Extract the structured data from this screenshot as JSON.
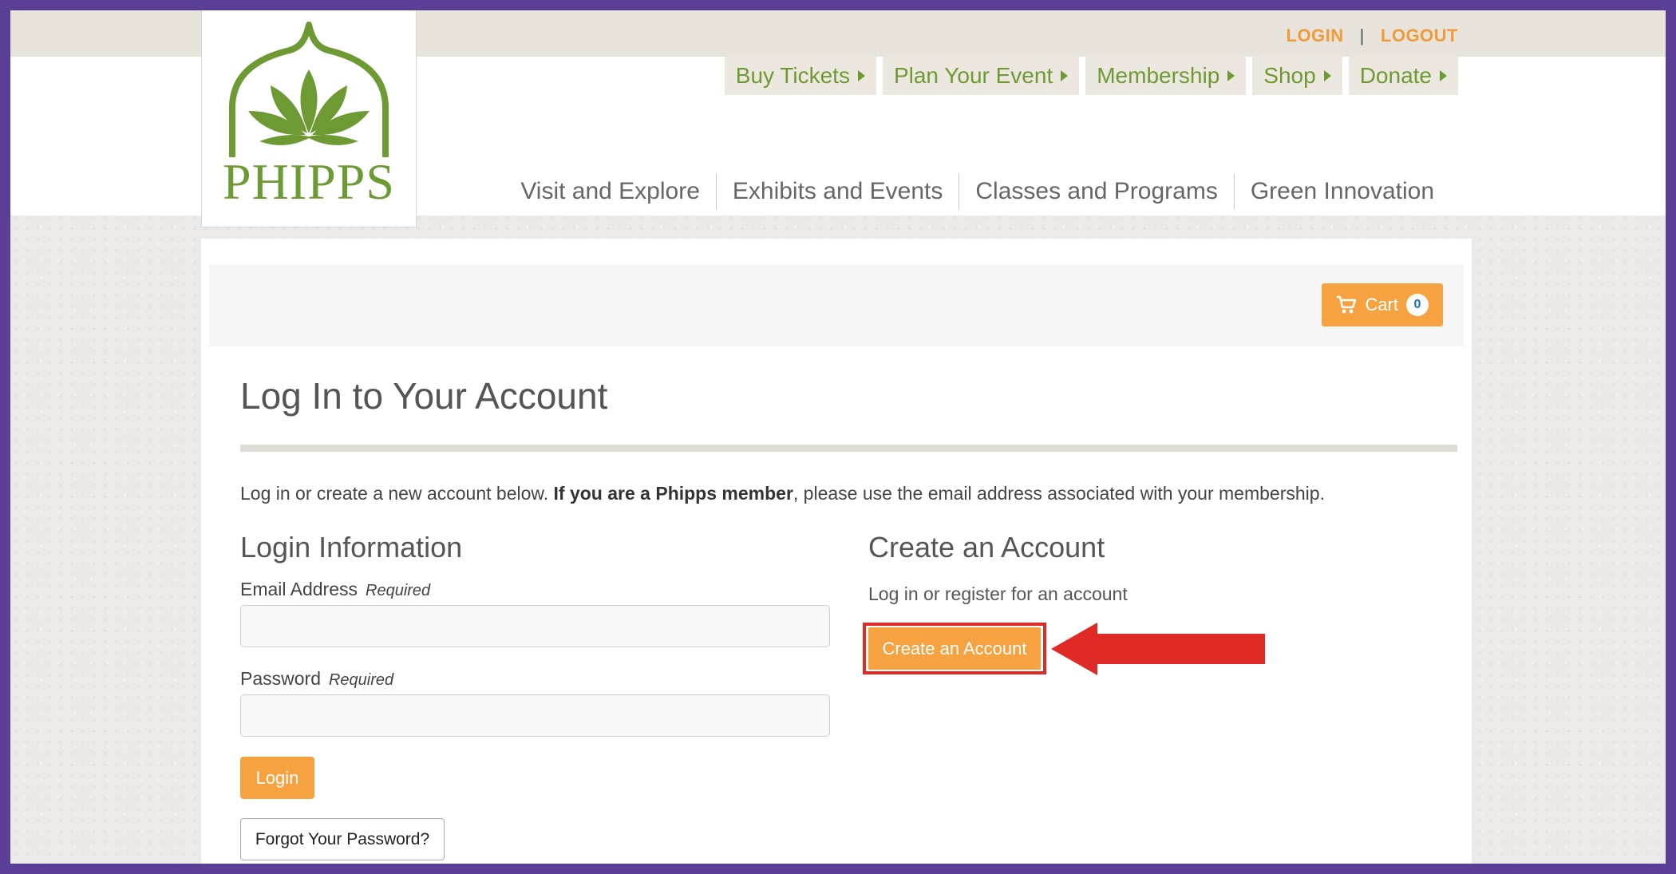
{
  "utility": {
    "login": "LOGIN",
    "separator": "|",
    "logout": "LOGOUT"
  },
  "logo": {
    "text": "PHIPPS"
  },
  "green_nav": [
    {
      "label": "Buy Tickets"
    },
    {
      "label": "Plan Your Event"
    },
    {
      "label": "Membership"
    },
    {
      "label": "Shop"
    },
    {
      "label": "Donate"
    }
  ],
  "main_nav": [
    {
      "label": "Visit and Explore"
    },
    {
      "label": "Exhibits and Events"
    },
    {
      "label": "Classes and Programs"
    },
    {
      "label": "Green Innovation"
    }
  ],
  "cart": {
    "label": "Cart",
    "count": "0"
  },
  "page": {
    "title": "Log In to Your Account",
    "intro_a": "Log in or create a new account below. ",
    "intro_bold": "If you are a Phipps member",
    "intro_b": ", please use the email address associated with your membership."
  },
  "login": {
    "heading": "Login Information",
    "email_label": "Email Address",
    "password_label": "Password",
    "required": "Required",
    "email_value": "",
    "password_value": "",
    "login_button": "Login",
    "forgot_button": "Forgot Your Password?"
  },
  "create": {
    "heading": "Create an Account",
    "subtext": "Log in or register for an account",
    "button": "Create an Account"
  },
  "colors": {
    "brand_green": "#6e9a34",
    "accent_orange": "#f6a240",
    "annotation_red": "#e02a25",
    "frame_purple": "#5b3f96"
  }
}
